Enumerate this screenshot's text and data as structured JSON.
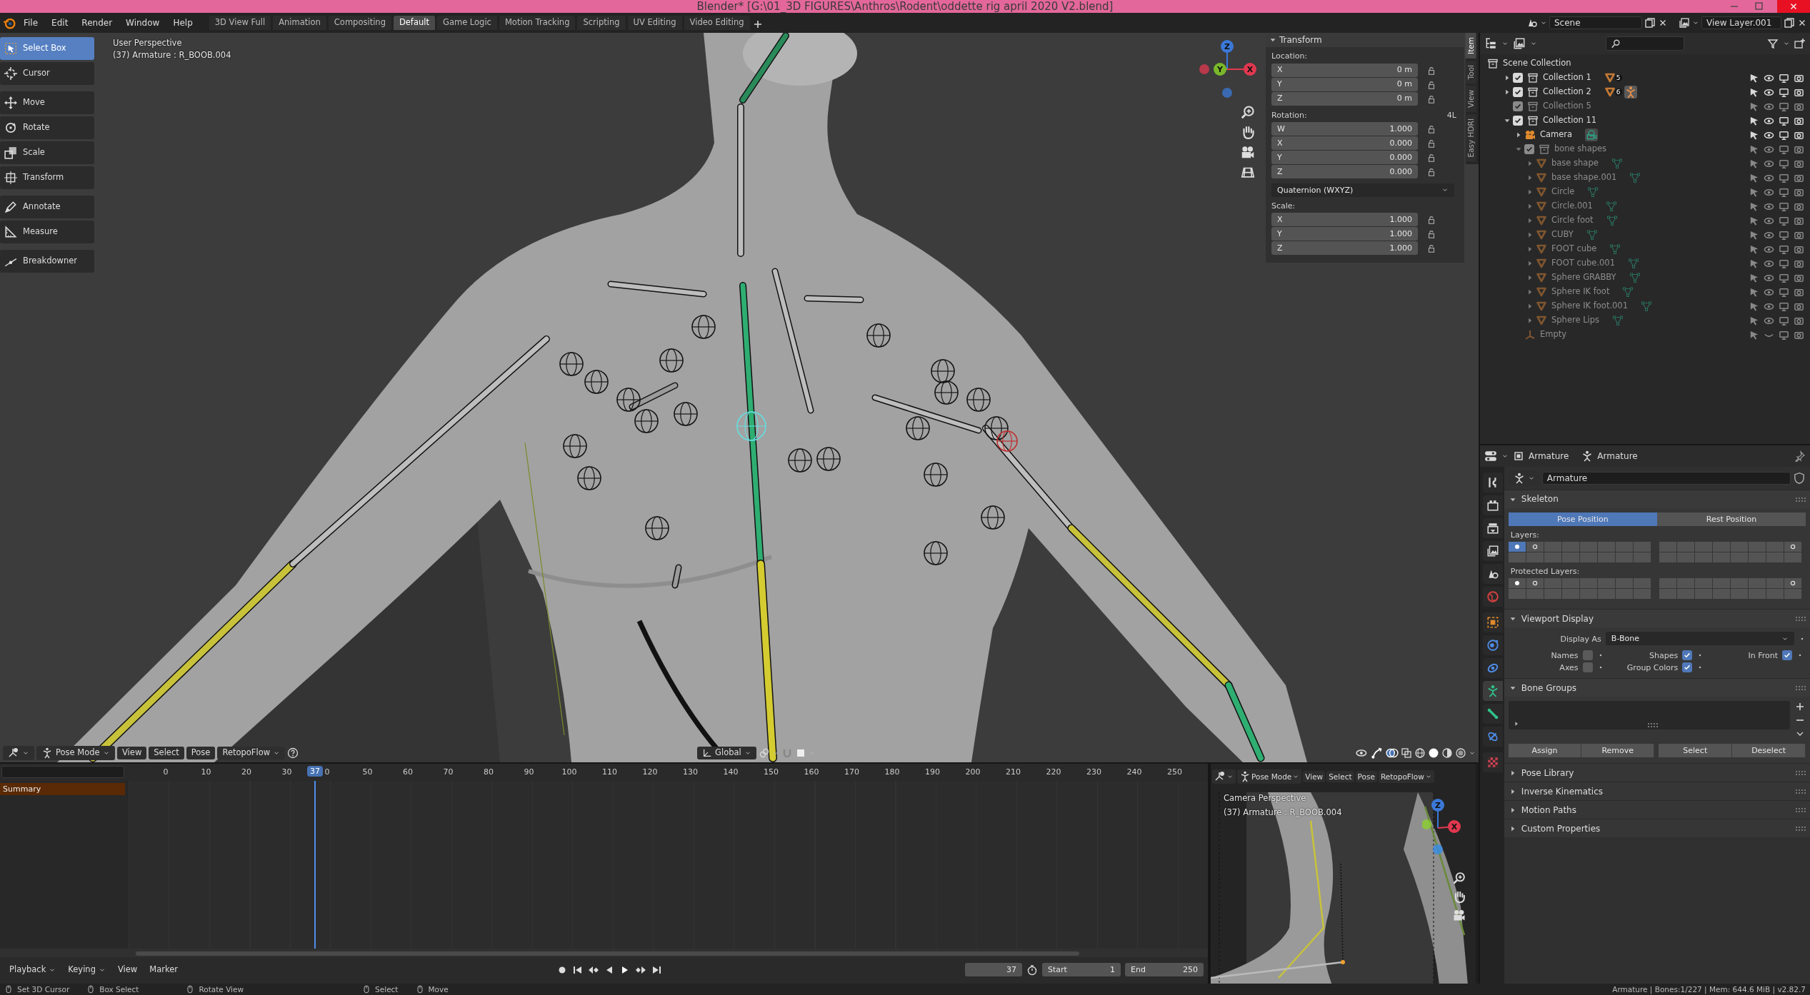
{
  "title_bar": {
    "title": "Blender* [G:\\01_3D FIGURES\\Anthros\\Rodent\\oddette rig april 2020 V2.blend]"
  },
  "menu": [
    "File",
    "Edit",
    "Render",
    "Window",
    "Help"
  ],
  "workspaces": [
    {
      "label": "3D View Full",
      "selected": false
    },
    {
      "label": "Animation",
      "selected": false
    },
    {
      "label": "Compositing",
      "selected": false
    },
    {
      "label": "Default",
      "selected": true
    },
    {
      "label": "Game Logic",
      "selected": false
    },
    {
      "label": "Motion Tracking",
      "selected": false
    },
    {
      "label": "Scripting",
      "selected": false
    },
    {
      "label": "UV Editing",
      "selected": false
    },
    {
      "label": "Video Editing",
      "selected": false
    }
  ],
  "scene": {
    "name": "Scene",
    "view_layer": "View Layer.001"
  },
  "viewport": {
    "view_name": "User Perspective",
    "active": "(37) Armature : R_BOOB.004",
    "tools": [
      {
        "label": "Select Box",
        "kind": "select",
        "selected": true
      },
      {
        "label": "Cursor",
        "kind": "cursor",
        "selected": false
      },
      {
        "label": "Move",
        "kind": "move",
        "selected": false
      },
      {
        "label": "Rotate",
        "kind": "rotate",
        "selected": false
      },
      {
        "label": "Scale",
        "kind": "scale",
        "selected": false
      },
      {
        "label": "Transform",
        "kind": "transform",
        "selected": false
      },
      {
        "label": "Annotate",
        "kind": "annotate",
        "selected": false
      },
      {
        "label": "Measure",
        "kind": "measure",
        "selected": false
      },
      {
        "label": "Breakdowner",
        "kind": "breakdown",
        "selected": false
      }
    ],
    "gizmo_axes": [
      "Z",
      "Y",
      "X"
    ],
    "sidebar_tabs": [
      {
        "label": "Item",
        "selected": true
      },
      {
        "label": "Tool",
        "selected": false
      },
      {
        "label": "View",
        "selected": false
      },
      {
        "label": "Easy HDRI",
        "selected": false
      }
    ],
    "transform": {
      "title": "Transform",
      "location_label": "Location:",
      "location": [
        {
          "axis": "X",
          "value": "0 m"
        },
        {
          "axis": "Y",
          "value": "0 m"
        },
        {
          "axis": "Z",
          "value": "0 m"
        }
      ],
      "rotation_label": "Rotation:",
      "rotation_lock": "4L",
      "rotation": [
        {
          "axis": "W",
          "value": "1.000"
        },
        {
          "axis": "X",
          "value": "0.000"
        },
        {
          "axis": "Y",
          "value": "0.000"
        },
        {
          "axis": "Z",
          "value": "0.000"
        }
      ],
      "rotation_mode": "Quaternion (WXYZ)",
      "scale_label": "Scale:",
      "scale": [
        {
          "axis": "X",
          "value": "1.000"
        },
        {
          "axis": "Y",
          "value": "1.000"
        },
        {
          "axis": "Z",
          "value": "1.000"
        }
      ]
    },
    "header": {
      "mode": "Pose Mode",
      "menus": [
        "View",
        "Select",
        "Pose"
      ],
      "addon": "RetopoFlow",
      "orientation": "Global"
    }
  },
  "timeline": {
    "ruler": [
      "0",
      "10",
      "20",
      "30",
      "0",
      "50",
      "60",
      "70",
      "80",
      "90",
      "100",
      "110",
      "120",
      "130",
      "140",
      "150",
      "160",
      "170",
      "180",
      "190",
      "200",
      "210",
      "220",
      "230",
      "240",
      "250"
    ],
    "current_frame": "37",
    "channels": [
      "Summary"
    ],
    "menus": [
      "Playback",
      "Keying",
      "View",
      "Marker"
    ],
    "frame": "37",
    "start_label": "Start",
    "start": "1",
    "end_label": "End",
    "end": "250"
  },
  "camera_view": {
    "mode": "Pose Mode",
    "menus": [
      "View",
      "Select",
      "Pose"
    ],
    "addon": "RetopoFlow",
    "view_name": "Camera Perspective",
    "active": "(37) Armature : R_BOOB.004",
    "gizmo_axes": [
      "Z",
      "X"
    ]
  },
  "outliner": {
    "root": "Scene Collection",
    "items": [
      {
        "name": "Collection 1",
        "kind": "collection",
        "checked": true,
        "expanded": false,
        "disabled": false,
        "hidden": false,
        "count": "5"
      },
      {
        "name": "Collection 2",
        "kind": "collection",
        "checked": true,
        "expanded": false,
        "disabled": false,
        "hidden": false,
        "count": "6",
        "armature": true
      },
      {
        "name": "Collection 5",
        "kind": "collection",
        "checked": true,
        "disabled": true,
        "hidden": false
      },
      {
        "name": "Collection 11",
        "kind": "collection",
        "checked": true,
        "expanded": true,
        "disabled": false,
        "hidden": false,
        "children": [
          {
            "name": "Camera",
            "kind": "camera",
            "expanded": false,
            "disabled": false,
            "hidden": false
          },
          {
            "name": "bone shapes",
            "kind": "collection",
            "checked": true,
            "expanded": true,
            "disabled": true,
            "hidden": false,
            "children": [
              {
                "name": "base shape",
                "kind": "mesh",
                "expanded": false,
                "disabled": true,
                "hidden": false
              },
              {
                "name": "base shape.001",
                "kind": "mesh",
                "expanded": false,
                "disabled": true,
                "hidden": false
              },
              {
                "name": "Circle",
                "kind": "mesh",
                "expanded": false,
                "disabled": true,
                "hidden": false
              },
              {
                "name": "Circle.001",
                "kind": "mesh",
                "expanded": false,
                "disabled": true,
                "hidden": false
              },
              {
                "name": "Circle foot",
                "kind": "mesh",
                "expanded": false,
                "disabled": true,
                "hidden": false
              },
              {
                "name": "CUBY",
                "kind": "mesh",
                "expanded": false,
                "disabled": true,
                "hidden": false
              },
              {
                "name": "FOOT cube",
                "kind": "mesh",
                "expanded": false,
                "disabled": true,
                "hidden": false
              },
              {
                "name": "FOOT cube.001",
                "kind": "mesh",
                "expanded": false,
                "disabled": true,
                "hidden": false
              },
              {
                "name": "Sphere GRABBY",
                "kind": "mesh",
                "expanded": false,
                "disabled": true,
                "hidden": false
              },
              {
                "name": "Sphere IK foot",
                "kind": "mesh",
                "expanded": false,
                "disabled": true,
                "hidden": false
              },
              {
                "name": "Sphere IK foot.001",
                "kind": "mesh",
                "expanded": false,
                "disabled": true,
                "hidden": false
              },
              {
                "name": "Sphere Lips",
                "kind": "mesh",
                "expanded": false,
                "disabled": true,
                "hidden": false
              }
            ]
          },
          {
            "name": "Empty",
            "kind": "empty",
            "disabled": true,
            "hidden": true
          }
        ]
      }
    ]
  },
  "properties": {
    "tabs": [
      {
        "kind": "tool",
        "selected": false
      },
      {
        "kind": "render",
        "selected": false
      },
      {
        "kind": "output",
        "selected": false
      },
      {
        "kind": "view_layer",
        "selected": false
      },
      {
        "kind": "scene",
        "selected": false
      },
      {
        "kind": "world",
        "selected": false
      },
      {
        "kind": "object",
        "selected": false
      },
      {
        "kind": "physics",
        "selected": false
      },
      {
        "kind": "constraints",
        "selected": false
      },
      {
        "kind": "data",
        "selected": true
      },
      {
        "kind": "bone",
        "selected": false
      },
      {
        "kind": "bone_constraint",
        "selected": false
      },
      {
        "kind": "texture",
        "selected": false
      }
    ],
    "breadcrumb": [
      "Armature",
      "Armature"
    ],
    "datablock": "Armature",
    "skeleton": {
      "title": "Skeleton",
      "expanded": true,
      "positions": [
        {
          "label": "Pose Position",
          "selected": true
        },
        {
          "label": "Rest Position",
          "selected": false
        }
      ],
      "layers_label": "Layers:",
      "layers": [
        {
          "selected": true,
          "kind": "filled"
        },
        {
          "selected": false,
          "kind": "hollow"
        },
        {
          "selected": false
        },
        {
          "selected": false
        },
        {
          "selected": false
        },
        {
          "selected": false
        },
        {
          "selected": false
        },
        {
          "selected": false
        },
        {
          "selected": false
        },
        {
          "selected": false
        },
        {
          "selected": false
        },
        {
          "selected": false
        },
        {
          "selected": false
        },
        {
          "selected": false
        },
        {
          "selected": false
        },
        {
          "selected": false,
          "kind": "hollow"
        },
        {
          "selected": false
        },
        {
          "selected": false
        },
        {
          "selected": false
        },
        {
          "selected": false
        },
        {
          "selected": false
        },
        {
          "selected": false
        },
        {
          "selected": false
        },
        {
          "selected": false
        },
        {
          "selected": false
        },
        {
          "selected": false
        },
        {
          "selected": false
        },
        {
          "selected": false
        },
        {
          "selected": false
        },
        {
          "selected": false
        },
        {
          "selected": false
        },
        {
          "selected": false
        }
      ],
      "protected_label": "Protected Layers:",
      "protected_layers": [
        {
          "selected": false,
          "kind": "filled"
        },
        {
          "selected": false,
          "kind": "hollow"
        },
        {
          "selected": false
        },
        {
          "selected": false
        },
        {
          "selected": false
        },
        {
          "selected": false
        },
        {
          "selected": false
        },
        {
          "selected": false
        },
        {
          "selected": false
        },
        {
          "selected": false
        },
        {
          "selected": false
        },
        {
          "selected": false
        },
        {
          "selected": false
        },
        {
          "selected": false
        },
        {
          "selected": false
        },
        {
          "selected": false,
          "kind": "hollow"
        },
        {
          "selected": false
        },
        {
          "selected": false
        },
        {
          "selected": false
        },
        {
          "selected": false
        },
        {
          "selected": false
        },
        {
          "selected": false
        },
        {
          "selected": false
        },
        {
          "selected": false
        },
        {
          "selected": false
        },
        {
          "selected": false
        },
        {
          "selected": false
        },
        {
          "selected": false
        },
        {
          "selected": false
        },
        {
          "selected": false
        },
        {
          "selected": false
        },
        {
          "selected": false
        }
      ]
    },
    "viewport_display": {
      "title": "Viewport Display",
      "expanded": true,
      "display_as_label": "Display As",
      "display_as": "B-Bone",
      "options": [
        {
          "label": "Names",
          "checked": false
        },
        {
          "label": "Shapes",
          "checked": true
        },
        {
          "label": "In Front",
          "checked": true
        },
        {
          "label": "Axes",
          "checked": false
        },
        {
          "label": "Group Colors",
          "checked": true
        }
      ]
    },
    "bone_groups": {
      "title": "Bone Groups",
      "expanded": true,
      "buttons": [
        "Assign",
        "Remove",
        "Select",
        "Deselect"
      ]
    },
    "collapsed_panels": [
      {
        "title": "Pose Library",
        "expanded": false
      },
      {
        "title": "Inverse Kinematics",
        "expanded": false
      },
      {
        "title": "Motion Paths",
        "expanded": false
      },
      {
        "title": "Custom Properties",
        "expanded": false
      }
    ]
  },
  "status_bar": {
    "hints": [
      "Set 3D Cursor",
      "Box Select",
      "Rotate View",
      "Select",
      "Move"
    ],
    "info": "Armature | Bones:1/227 | Mem: 644.6 MiB | v2.82.7"
  }
}
